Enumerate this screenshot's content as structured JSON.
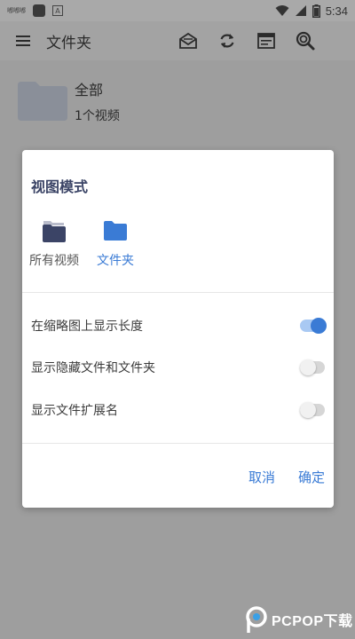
{
  "status_bar": {
    "time": "5:34",
    "small_label": "嘟嘟嘟",
    "a_icon_label": "A"
  },
  "app_bar": {
    "title": "文件夹",
    "icons": [
      "menu-icon",
      "mail-icon",
      "refresh-icon",
      "window-icon",
      "search-icon"
    ]
  },
  "folder": {
    "name": "全部",
    "count": "1个视频"
  },
  "dialog": {
    "title": "视图模式",
    "modes": [
      {
        "label": "所有视频",
        "selected": false
      },
      {
        "label": "文件夹",
        "selected": true
      }
    ],
    "settings": [
      {
        "label": "在缩略图上显示长度",
        "enabled": true
      },
      {
        "label": "显示隐藏文件和文件夹",
        "enabled": false
      },
      {
        "label": "显示文件扩展名",
        "enabled": false
      }
    ],
    "cancel": "取消",
    "confirm": "确定"
  },
  "watermark": {
    "text": "PCPOP下载"
  },
  "colors": {
    "accent": "#3a7bd5",
    "dark_folder": "#3b4466",
    "overlay": "#9e9e9e"
  }
}
